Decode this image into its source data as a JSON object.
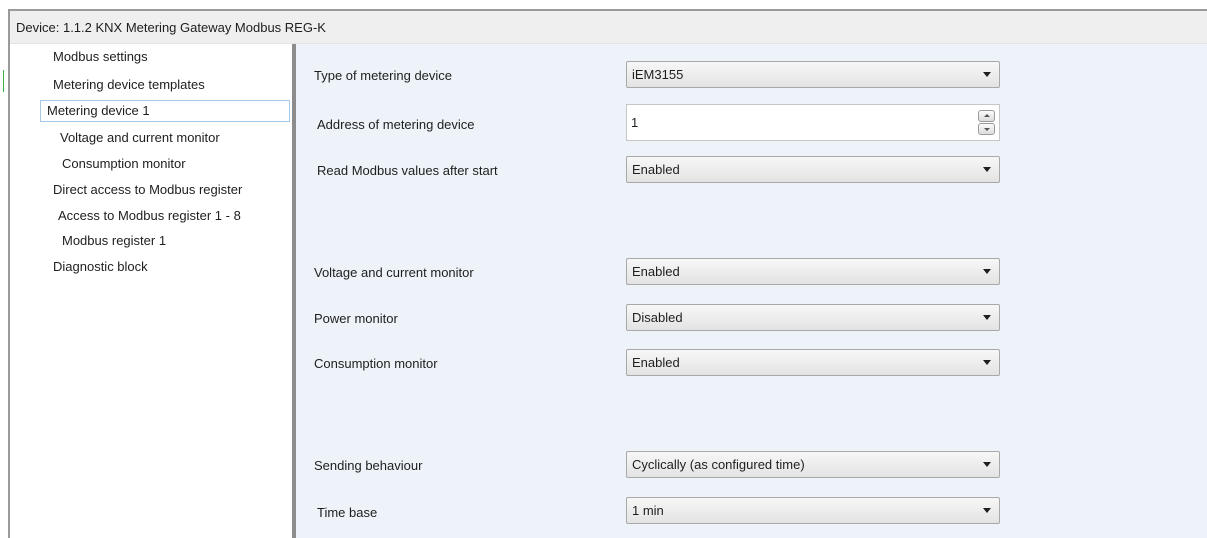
{
  "window": {
    "title": "Device: 1.1.2  KNX Metering Gateway Modbus REG-K"
  },
  "sidebar": {
    "items": [
      {
        "label": "Modbus settings"
      },
      {
        "label": "Metering device templates"
      },
      {
        "label": "Metering device 1",
        "selected": true
      },
      {
        "label": "Voltage and current monitor"
      },
      {
        "label": "Consumption monitor"
      },
      {
        "label": "Direct access to Modbus register"
      },
      {
        "label": "Access to Modbus register 1 - 8"
      },
      {
        "label": "Modbus register 1"
      },
      {
        "label": "Diagnostic block"
      }
    ]
  },
  "params": {
    "type_of_metering_device": {
      "label": "Type of metering device",
      "value": "iEM3155"
    },
    "address_of_metering_device": {
      "label": "Address of metering device",
      "value": "1"
    },
    "read_modbus_values": {
      "label": "Read Modbus values after start",
      "value": "Enabled"
    },
    "voltage_current_monitor": {
      "label": "Voltage and current monitor",
      "value": "Enabled"
    },
    "power_monitor": {
      "label": "Power monitor",
      "value": "Disabled"
    },
    "consumption_monitor": {
      "label": "Consumption monitor",
      "value": "Enabled"
    },
    "sending_behaviour": {
      "label": "Sending behaviour",
      "value": "Cyclically (as configured time)"
    },
    "time_base": {
      "label": "Time base",
      "value": "1 min"
    }
  },
  "icons": {
    "dropdown": "chevron-down-icon",
    "spin_up": "spin-up-icon",
    "spin_down": "spin-down-icon"
  },
  "colors": {
    "main_background": "#edf3f8",
    "selection_border": "#a6c8e8",
    "title_bar": "#efefef"
  }
}
